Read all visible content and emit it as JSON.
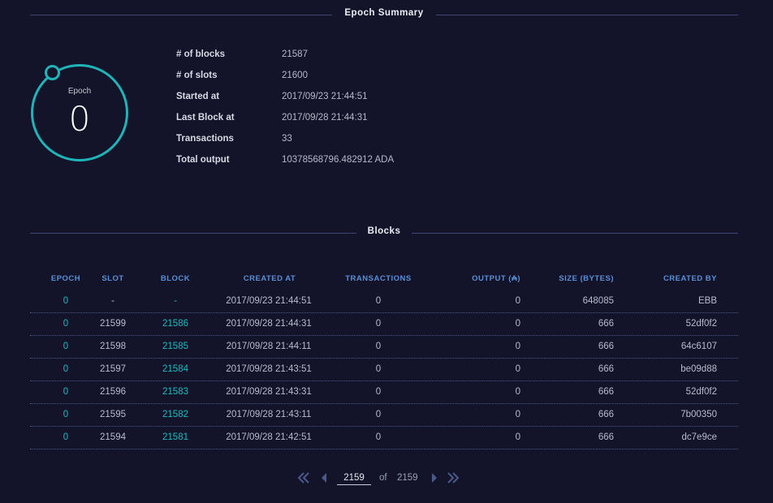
{
  "summary": {
    "title": "Epoch Summary",
    "epoch_label": "Epoch",
    "epoch_value": "0",
    "rows": [
      {
        "key": "# of blocks",
        "value": "21587"
      },
      {
        "key": "# of slots",
        "value": "21600"
      },
      {
        "key": "Started at",
        "value": "2017/09/23 21:44:51"
      },
      {
        "key": "Last Block at",
        "value": "2017/09/28 21:44:31"
      },
      {
        "key": "Transactions",
        "value": "33"
      },
      {
        "key": "Total output",
        "value": "10378568796.482912 ADA"
      }
    ]
  },
  "blocks": {
    "title": "Blocks",
    "headers": [
      "EPOCH",
      "SLOT",
      "BLOCK",
      "CREATED AT",
      "TRANSACTIONS",
      "OUTPUT (₳)",
      "SIZE (BYTES)",
      "CREATED BY"
    ],
    "rows": [
      [
        "0",
        "-",
        "-",
        "2017/09/23 21:44:51",
        "0",
        "0",
        "648085",
        "EBB"
      ],
      [
        "0",
        "21599",
        "21586",
        "2017/09/28 21:44:31",
        "0",
        "0",
        "666",
        "52df0f2"
      ],
      [
        "0",
        "21598",
        "21585",
        "2017/09/28 21:44:11",
        "0",
        "0",
        "666",
        "64c6107"
      ],
      [
        "0",
        "21597",
        "21584",
        "2017/09/28 21:43:51",
        "0",
        "0",
        "666",
        "be09d88"
      ],
      [
        "0",
        "21596",
        "21583",
        "2017/09/28 21:43:31",
        "0",
        "0",
        "666",
        "52df0f2"
      ],
      [
        "0",
        "21595",
        "21582",
        "2017/09/28 21:43:11",
        "0",
        "0",
        "666",
        "7b00350"
      ],
      [
        "0",
        "21594",
        "21581",
        "2017/09/28 21:42:51",
        "0",
        "0",
        "666",
        "dc7e9ce"
      ]
    ]
  },
  "pagination": {
    "current_page": "2159",
    "of_label": "of",
    "total_pages": "2159",
    "icons": {
      "first": "double-chevron-left-icon",
      "prev": "chevron-left-icon",
      "next": "chevron-right-icon",
      "last": "double-chevron-right-icon"
    }
  },
  "colors": {
    "background": "#13132a",
    "accent": "#1fb5b8",
    "header": "#5a8fd6"
  }
}
